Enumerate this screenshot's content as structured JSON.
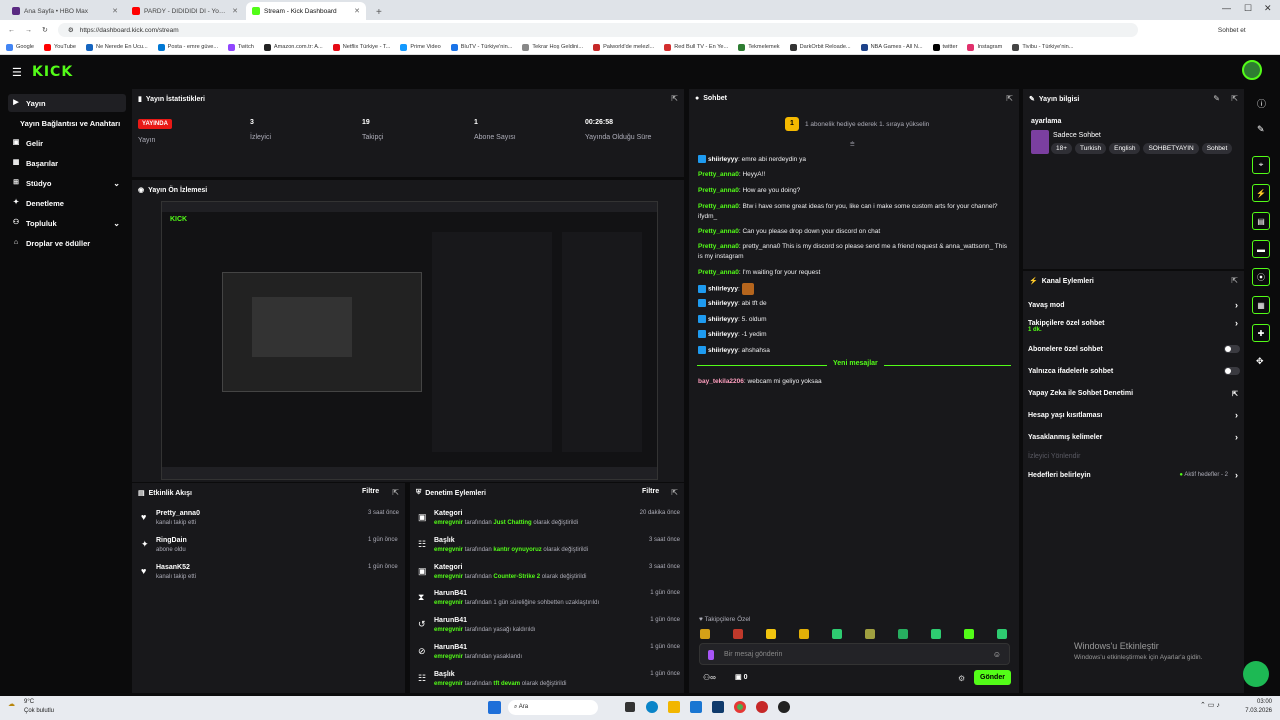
{
  "browser": {
    "tabs": [
      {
        "label": "Ana Sayfa • HBO Max",
        "color": "#5a2a82"
      },
      {
        "label": "PARDY - DIDIDIDI DI - YouTube",
        "color": "#ff0000"
      },
      {
        "label": "Stream - Kick Dashboard",
        "color": "#53fc18"
      }
    ],
    "new_tab": "+",
    "url": "https://dashboard.kick.com/stream",
    "chat_button": "Sohbet et"
  },
  "bookmarks": [
    {
      "label": "Google",
      "color": "#4285f4"
    },
    {
      "label": "YouTube",
      "color": "#ff0000"
    },
    {
      "label": "Ne Nerede En Ucu...",
      "color": "#1565c0"
    },
    {
      "label": "Posta - emre güve...",
      "color": "#0078d4"
    },
    {
      "label": "Twitch",
      "color": "#9146ff"
    },
    {
      "label": "Amazon.com.tr: A...",
      "color": "#222"
    },
    {
      "label": "Netflix Türkiye - T...",
      "color": "#e50914"
    },
    {
      "label": "Prime Video",
      "color": "#1399ff"
    },
    {
      "label": "BluTV - Türkiye'nin...",
      "color": "#1a73e8"
    },
    {
      "label": "Tekrar Hoş Geldini...",
      "color": "#888"
    },
    {
      "label": "Palworld'de melezl...",
      "color": "#c62828"
    },
    {
      "label": "Red Bull TV - En Ye...",
      "color": "#d32f2f"
    },
    {
      "label": "Tekmelemek",
      "color": "#2e7d32"
    },
    {
      "label": "DarkOrbit Reloade...",
      "color": "#333"
    },
    {
      "label": "NBA Games - All N...",
      "color": "#1d428a"
    },
    {
      "label": "twitter",
      "color": "#000"
    },
    {
      "label": "Instagram",
      "color": "#e1306c"
    },
    {
      "label": "Tivibu - Türkiye'nin...",
      "color": "#444"
    }
  ],
  "logo": "KICK",
  "nav": [
    {
      "label": "Yayın",
      "icon": "▶"
    },
    {
      "label": "Yayın Bağlantısı ve Anahtarı",
      "icon": ""
    },
    {
      "label": "Gelir",
      "icon": "▣"
    },
    {
      "label": "Başarılar",
      "icon": "▦"
    },
    {
      "label": "Stüdyo",
      "icon": "⊞"
    },
    {
      "label": "Denetleme",
      "icon": "✦"
    },
    {
      "label": "Topluluk",
      "icon": "⚇"
    },
    {
      "label": "Droplar ve ödüller",
      "icon": "⌂"
    }
  ],
  "stats": {
    "title": "Yayın İstatistikleri",
    "live": "YAYINDA",
    "stream_label": "Yayın",
    "viewers": "3",
    "viewers_label": "İzleyici",
    "followers": "19",
    "followers_label": "Takipçi",
    "subs": "1",
    "subs_label": "Abone Sayısı",
    "duration": "00:26:58",
    "duration_label": "Yayında Olduğu Süre"
  },
  "preview": {
    "title": "Yayın Ön İzlemesi"
  },
  "activity": {
    "title": "Etkinlik Akışı",
    "filter": "Filtre",
    "items": [
      {
        "name": "Pretty_anna0",
        "sub": "kanalı takip etti",
        "time": "3 saat önce"
      },
      {
        "name": "RingDain",
        "sub": "abone oldu",
        "time": "1 gün önce"
      },
      {
        "name": "HasanK52",
        "sub": "kanalı takip etti",
        "time": "1 gün önce"
      }
    ]
  },
  "mod": {
    "title": "Denetim Eylemleri",
    "filter": "Filtre",
    "items": [
      {
        "title": "Kategori",
        "mod": "emregvnir",
        "pre": "tarafından",
        "val": "Just Chatting",
        "post": "olarak değiştirildi",
        "time": "20 dakika önce"
      },
      {
        "title": "Başlık",
        "mod": "emregvnir",
        "pre": "tarafından",
        "val": "kantır oynuyoruz",
        "post": "olarak değiştirildi",
        "time": "3 saat önce"
      },
      {
        "title": "Kategori",
        "mod": "emregvnir",
        "pre": "tarafından",
        "val": "Counter-Strike 2",
        "post": "olarak değiştirildi",
        "time": "3 saat önce"
      },
      {
        "title": "HarunB41",
        "mod": "emregvnir",
        "pre": "tarafından 1 gün süreliğine sohbetten uzaklaştırıldı",
        "val": "",
        "post": "",
        "time": "1 gün önce"
      },
      {
        "title": "HarunB41",
        "mod": "emregvnir",
        "pre": "tarafından yasağı kaldırıldı",
        "val": "",
        "post": "",
        "time": "1 gün önce"
      },
      {
        "title": "HarunB41",
        "mod": "emregvnir",
        "pre": "tarafından yasaklandı",
        "val": "",
        "post": "",
        "time": "1 gün önce"
      },
      {
        "title": "Başlık",
        "mod": "emregvnir",
        "pre": "tarafından",
        "val": "tft devam",
        "post": "olarak değiştirildi",
        "time": "1 gün önce"
      }
    ]
  },
  "chat": {
    "title": "Sohbet",
    "pinned": "1 abonelik hediye ederek 1. sıraya yükselin",
    "pinned_count": "1",
    "new_messages": "Yeni mesajlar",
    "followers_only": "Takipçilere Özel",
    "placeholder": "Bir mesaj gönderin",
    "send": "Gönder",
    "count": "0",
    "messages": [
      {
        "user": "shiirleyyy",
        "text": "emre abi nerdeydin ya",
        "badge": true
      },
      {
        "user": "Pretty_anna0",
        "text": "HeyyA!!",
        "badge": false
      },
      {
        "user": "Pretty_anna0",
        "text": "How are you doing?",
        "badge": false
      },
      {
        "user": "Pretty_anna0",
        "text": "Btw i have some great ideas for you, like can i make some custom arts for your channel? ifydm_",
        "badge": false
      },
      {
        "user": "Pretty_anna0",
        "text": "Can you please drop down your discord on chat",
        "badge": false
      },
      {
        "user": "Pretty_anna0",
        "text": "pretty_anna0 This is my discord so please send me a friend request & anna_wattsonn_ This is my instagram",
        "badge": false
      },
      {
        "user": "Pretty_anna0",
        "text": "I'm waiting for your request",
        "badge": false
      },
      {
        "user": "shiirleyyy",
        "text": "",
        "badge": true
      },
      {
        "user": "shiirleyyy",
        "text": "abi tft de",
        "badge": true
      },
      {
        "user": "shiirleyyy",
        "text": "5. oldum",
        "badge": true
      },
      {
        "user": "shiirleyyy",
        "text": "-1 yedim",
        "badge": true
      },
      {
        "user": "shiirleyyy",
        "text": "ahshahsa",
        "badge": true
      }
    ],
    "after": {
      "user": "bay_tekila2206",
      "text": "webcam mi geliyo yoksaa"
    }
  },
  "info": {
    "title": "Yayın bilgisi",
    "stream_title": "ayarlama",
    "category": "Sadece Sohbet",
    "tags": [
      "18+",
      "Turkish",
      "English",
      "SOHBETYAYIN",
      "Sohbet"
    ]
  },
  "channel": {
    "title": "Kanal Eylemleri",
    "items": [
      {
        "label": "Yavaş mod",
        "sub": "",
        "kind": "chevron"
      },
      {
        "label": "Takipçilere özel sohbet",
        "sub": "1 dk.",
        "kind": "chevron"
      },
      {
        "label": "Abonelere özel sohbet",
        "sub": "",
        "kind": "toggle"
      },
      {
        "label": "Yalnızca ifadelerle sohbet",
        "sub": "",
        "kind": "toggle"
      },
      {
        "label": "Yapay Zeka ile Sohbet Denetimi",
        "sub": "",
        "kind": "ext"
      },
      {
        "label": "Hesap yaşı kısıtlaması",
        "sub": "",
        "kind": "chevron"
      },
      {
        "label": "Yasaklanmış kelimeler",
        "sub": "",
        "kind": "chevron"
      },
      {
        "label": "İzleyici Yönlendir",
        "sub": "",
        "kind": "disabled"
      },
      {
        "label": "Hedefleri belirleyin",
        "sub": "",
        "kind": "goal",
        "extra": "Aktif hedefler - 2"
      }
    ]
  },
  "watermark": {
    "line1": "Windows'u Etkinleştir",
    "line2": "Windows'u etkinleştirmek için Ayarlar'a gidin."
  },
  "taskbar": {
    "temp": "9°C",
    "weather": "Çok bulutlu",
    "search": "Ara",
    "time": "03:00",
    "date": "7.03.2026"
  }
}
